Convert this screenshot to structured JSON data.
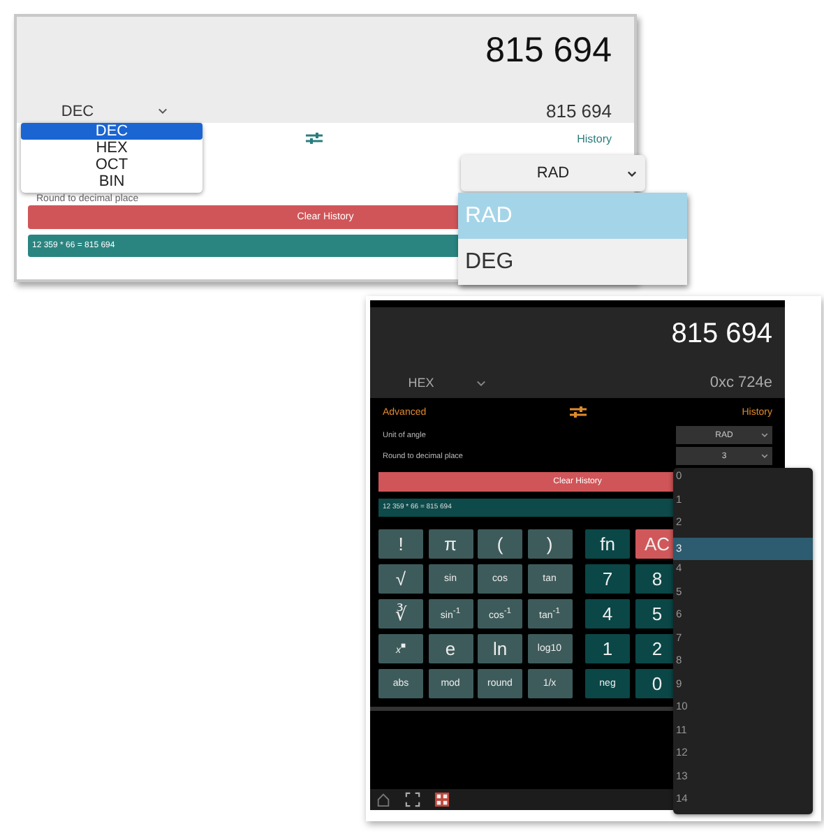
{
  "light_calculator": {
    "display": "815 694",
    "base_select": "DEC",
    "converted": "815 694",
    "history_link": "History",
    "round_label": "Round to decimal place",
    "clear_button": "Clear History",
    "history_entries": [
      "12 359 * 66 = 815 694"
    ],
    "base_options": [
      {
        "label": "DEC",
        "selected": true
      },
      {
        "label": "HEX",
        "selected": false
      },
      {
        "label": "OCT",
        "selected": false
      },
      {
        "label": "BIN",
        "selected": false
      }
    ],
    "angle_select": "RAD",
    "angle_options": [
      {
        "label": "RAD",
        "selected": true
      },
      {
        "label": "DEG",
        "selected": false
      }
    ]
  },
  "dark_calculator": {
    "display": "815 694",
    "base_select": "HEX",
    "converted": "0xc 724e",
    "advanced_link": "Advanced",
    "history_link": "History",
    "settings": [
      {
        "label": "Unit of angle",
        "value": "RAD"
      },
      {
        "label": "Round to decimal place",
        "value": "3"
      }
    ],
    "clear_button": "Clear History",
    "history_entries": [
      "12 359 * 66 = 815 694"
    ],
    "keys": [
      {
        "label": "!",
        "kind": "func"
      },
      {
        "label": "π",
        "kind": "func"
      },
      {
        "label": "(",
        "kind": "func"
      },
      {
        "label": ")",
        "kind": "func"
      },
      {
        "label": "fn",
        "kind": "num"
      },
      {
        "label": "AC",
        "kind": "clear"
      },
      {
        "label": "√",
        "kind": "func"
      },
      {
        "label": "sin",
        "kind": "func"
      },
      {
        "label": "cos",
        "kind": "func"
      },
      {
        "label": "tan",
        "kind": "func"
      },
      {
        "label": "7",
        "kind": "num"
      },
      {
        "label": "8",
        "kind": "num"
      },
      {
        "label": "∛",
        "kind": "func"
      },
      {
        "label": "sin$^{-1}$",
        "kind": "func"
      },
      {
        "label": "cos$^{-1}$",
        "kind": "func"
      },
      {
        "label": "tan$^{-1}$",
        "kind": "func"
      },
      {
        "label": "4",
        "kind": "num"
      },
      {
        "label": "5",
        "kind": "num"
      },
      {
        "label": "*x*$^{■}$",
        "kind": "func"
      },
      {
        "label": "e",
        "kind": "func"
      },
      {
        "label": "ln",
        "kind": "func"
      },
      {
        "label": "log10",
        "kind": "func"
      },
      {
        "label": "1",
        "kind": "num"
      },
      {
        "label": "2",
        "kind": "num"
      },
      {
        "label": "abs",
        "kind": "func"
      },
      {
        "label": "mod",
        "kind": "func"
      },
      {
        "label": "round",
        "kind": "func"
      },
      {
        "label": "1/x",
        "kind": "func"
      },
      {
        "label": "neg",
        "kind": "num"
      },
      {
        "label": "0",
        "kind": "num"
      }
    ],
    "decimal_options": [
      {
        "label": "0",
        "selected": false
      },
      {
        "label": "1",
        "selected": false
      },
      {
        "label": "2",
        "selected": false
      },
      {
        "label": "3",
        "selected": true
      },
      {
        "label": "4",
        "selected": false
      },
      {
        "label": "5",
        "selected": false
      },
      {
        "label": "6",
        "selected": false
      },
      {
        "label": "7",
        "selected": false
      },
      {
        "label": "8",
        "selected": false
      },
      {
        "label": "9",
        "selected": false
      },
      {
        "label": "10",
        "selected": false
      },
      {
        "label": "11",
        "selected": false
      },
      {
        "label": "12",
        "selected": false
      },
      {
        "label": "13",
        "selected": false
      },
      {
        "label": "14",
        "selected": false
      }
    ]
  }
}
